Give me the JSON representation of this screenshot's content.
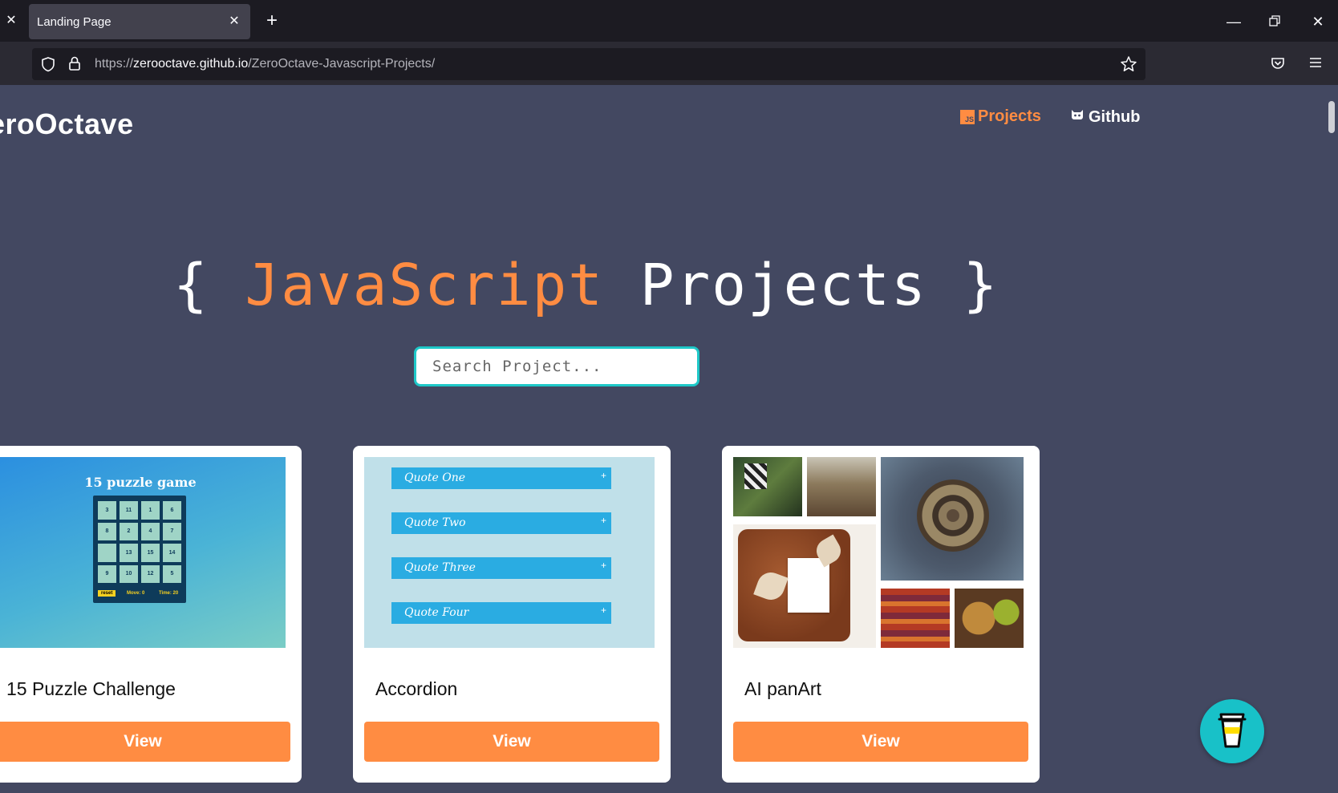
{
  "browser": {
    "tab_title": "Landing Page",
    "url_prefix": "https://",
    "url_host": "zerooctave.github.io",
    "url_path": "/ZeroOctave-Javascript-Projects/"
  },
  "header": {
    "brand": "eroOctave",
    "nav_projects": "Projects",
    "nav_projects_badge": "JS",
    "nav_github": "Github"
  },
  "hero": {
    "open_brace": "{",
    "word_js": "JavaScript",
    "word_projects": "Projects",
    "close_brace": "}"
  },
  "search": {
    "placeholder": "Search Project..."
  },
  "colors": {
    "background": "#434861",
    "accent": "#ff8c42",
    "teal": "#1ec8c8"
  },
  "cards": [
    {
      "title": "15 Puzzle Challenge",
      "button": "View",
      "preview": {
        "heading": "15 puzzle game",
        "tiles": [
          "3",
          "11",
          "1",
          "6",
          "8",
          "2",
          "4",
          "7",
          "",
          "13",
          "15",
          "14",
          "9",
          "10",
          "12",
          "5"
        ],
        "reset": "reset",
        "moves": "Move: 0",
        "time": "Time: 20"
      }
    },
    {
      "title": "Accordion",
      "button": "View",
      "preview": {
        "items": [
          "Quote One",
          "Quote Two",
          "Quote Three",
          "Quote Four"
        ],
        "plus": "+"
      }
    },
    {
      "title": "AI panArt",
      "button": "View"
    }
  ]
}
